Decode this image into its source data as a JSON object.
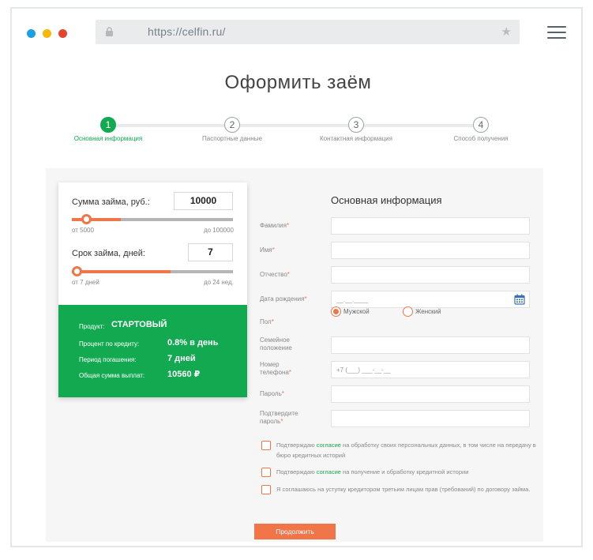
{
  "browser": {
    "dot_colors": [
      "#1aa0e6",
      "#f5b70a",
      "#e5452a"
    ],
    "url": "https://celfin.ru/",
    "lock_icon": "lock-icon",
    "star_icon": "star-icon",
    "menu_icon": "hamburger-menu-icon"
  },
  "page": {
    "title": "Оформить заём"
  },
  "steps": [
    {
      "num": "1",
      "label": "Основная информация",
      "active": true
    },
    {
      "num": "2",
      "label": "Паспортные данные",
      "active": false
    },
    {
      "num": "3",
      "label": "Контактная информация",
      "active": false
    },
    {
      "num": "4",
      "label": "Способ получения",
      "active": false
    }
  ],
  "calculator": {
    "amount_label": "Сумма займа, руб.:",
    "amount_value": "10000",
    "amount_min": "от 5000",
    "amount_max": "до 100000",
    "amount_fraction": 0.05,
    "term_label": "Срок займа, дней:",
    "term_value": "7",
    "term_min": "от 7 дней",
    "term_max": "до 24 нед.",
    "term_fraction": 0.0
  },
  "summary": {
    "product_label": "Продукт:",
    "product_value": "СТАРТОВЫЙ",
    "rate_label": "Процент по кредиту:",
    "rate_value": "0.8% в день",
    "period_label": "Период погашения:",
    "period_value": "7 дней",
    "total_label": "Общая сумма выплат:",
    "total_value": "10560 ₽"
  },
  "form": {
    "title": "Основная информация",
    "last_name": "Фамилия",
    "first_name": "Имя",
    "patronymic": "Отчество",
    "birth_date": "Дата рождения",
    "birth_placeholder": "__.__.____",
    "gender": "Пол",
    "gender_male": "Мужской",
    "gender_female": "Женский",
    "marital_1": "Семейное",
    "marital_2": "положение",
    "phone_1": "Номер",
    "phone_2": "телефона",
    "phone_placeholder": "+7 (___) ___-__-__",
    "password": "Пароль",
    "confirm_1": "Подтвердите",
    "confirm_2": "пароль",
    "req": "*"
  },
  "consents": [
    {
      "pre": "Подтверждаю ",
      "link": "согласие",
      "post": " на обработку своих персональных данных, в том числе на передачу в бюро кредитных историй"
    },
    {
      "pre": "Подтверждаю ",
      "link": "согласие",
      "post": " на получение и обработку кредитной истории"
    },
    {
      "pre": "Я соглашаюсь на уступку кредитором третьим лицам прав (требований) по договору займа.",
      "link": "",
      "post": ""
    }
  ],
  "submit_label": "Продолжить",
  "colors": {
    "accent_green": "#13a951",
    "accent_orange": "#f0764a"
  }
}
